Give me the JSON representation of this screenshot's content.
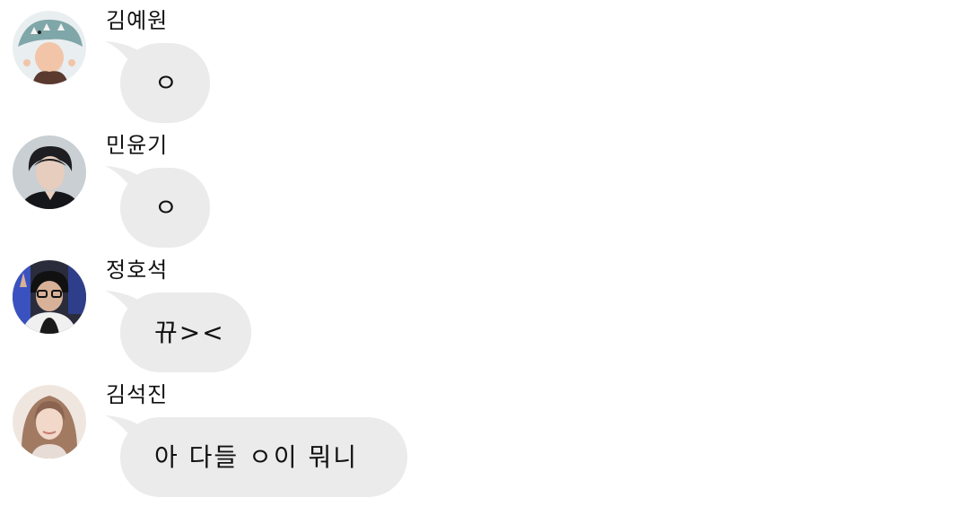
{
  "messages": [
    {
      "sender": "김예원",
      "text": "ㅇ",
      "avatar": "user-avatar-photo-shark-hat"
    },
    {
      "sender": "민윤기",
      "text": "ㅇ",
      "avatar": "user-avatar-photo-dark-hair"
    },
    {
      "sender": "정호석",
      "text": "뀨><",
      "avatar": "user-avatar-photo-glasses"
    },
    {
      "sender": "김석진",
      "text": "아 다들 ㅇ이 뭐니",
      "avatar": "user-avatar-photo-long-hair"
    }
  ],
  "colors": {
    "bubble": "#ebebeb",
    "text": "#111111",
    "background": "#ffffff"
  }
}
